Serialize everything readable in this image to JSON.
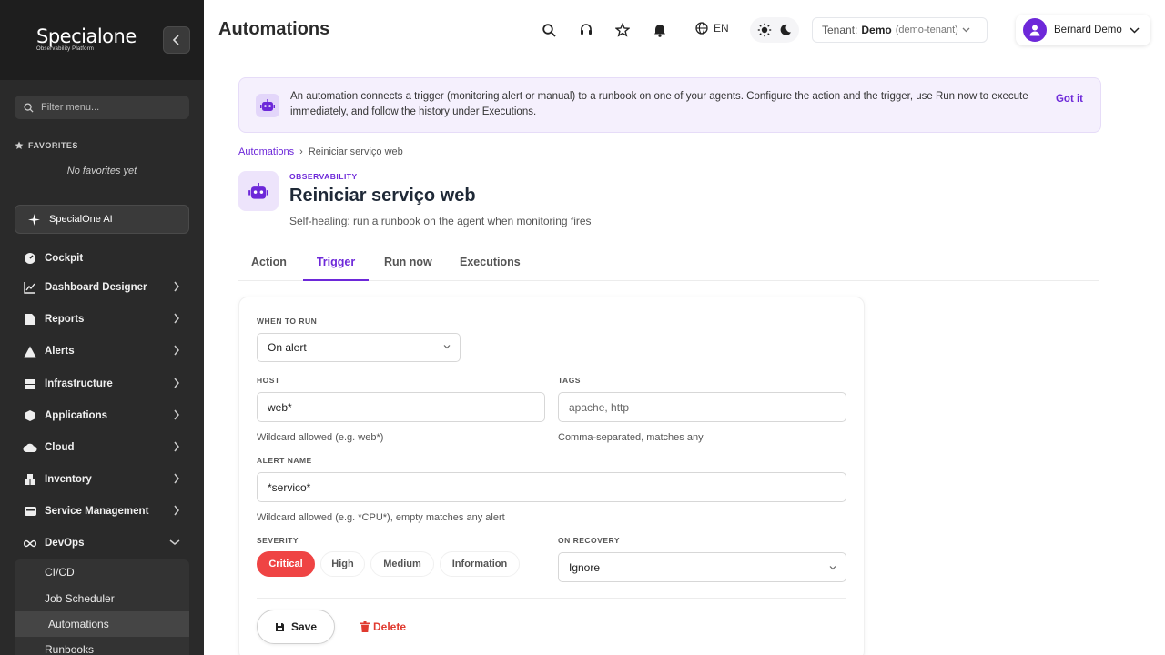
{
  "sidebar": {
    "logo": "Specialone",
    "logo_sub": "Observability Platform",
    "filter_placeholder": "Filter menu...",
    "favorites_title": "FAVORITES",
    "favorites_empty": "No favorites yet",
    "ai_label": "SpecialOne AI",
    "items": [
      {
        "label": "Cockpit",
        "icon": "gauge-icon"
      },
      {
        "label": "Dashboard Designer",
        "icon": "chart-line-icon"
      },
      {
        "label": "Reports",
        "icon": "file-icon"
      },
      {
        "label": "Alerts",
        "icon": "warning-icon"
      },
      {
        "label": "Infrastructure",
        "icon": "server-icon"
      },
      {
        "label": "Applications",
        "icon": "box-icon"
      },
      {
        "label": "Cloud",
        "icon": "cloud-icon"
      },
      {
        "label": "Inventory",
        "icon": "boxes-icon"
      },
      {
        "label": "Service Management",
        "icon": "service-icon"
      },
      {
        "label": "DevOps",
        "icon": "infinity-icon"
      }
    ],
    "devops_sub": [
      "CI/CD",
      "Job Scheduler",
      "Automations",
      "Runbooks"
    ]
  },
  "topbar": {
    "title": "Automations",
    "lang": "EN",
    "tenant_label": "Tenant:",
    "tenant_name": "Demo",
    "tenant_id": "(demo-tenant)",
    "user": "Bernard Demo"
  },
  "banner": {
    "text": "An automation connects a trigger (monitoring alert or manual) to a runbook on one of your agents. Configure the action and the trigger, use Run now to execute immediately, and follow the history under Executions.",
    "dismiss": "Got it"
  },
  "breadcrumb": {
    "root": "Automations",
    "sep": "›",
    "current": "Reiniciar serviço web"
  },
  "header": {
    "eyebrow": "OBSERVABILITY",
    "title": "Reiniciar serviço web",
    "subtitle": "Self-healing: run a runbook on the agent when monitoring fires"
  },
  "tabs": [
    "Action",
    "Trigger",
    "Run now",
    "Executions"
  ],
  "form": {
    "when_label": "WHEN TO RUN",
    "when_value": "On alert",
    "host_label": "HOST",
    "host_value": "web*",
    "host_hint": "Wildcard allowed (e.g. web*)",
    "tags_label": "TAGS",
    "tags_placeholder": "apache, http",
    "tags_hint": "Comma-separated, matches any",
    "alert_label": "ALERT NAME",
    "alert_value": "*servico*",
    "alert_hint": "Wildcard allowed (e.g. *CPU*), empty matches any alert",
    "severity_label": "SEVERITY",
    "severities": [
      "Critical",
      "High",
      "Medium",
      "Information"
    ],
    "severity_selected": "Critical",
    "recovery_label": "ON RECOVERY",
    "recovery_value": "Ignore",
    "save": "Save",
    "delete": "Delete"
  },
  "colors": {
    "accent": "#6d28d9",
    "critical": "#ef4444",
    "sidebar_bg": "#2a2a2a"
  }
}
